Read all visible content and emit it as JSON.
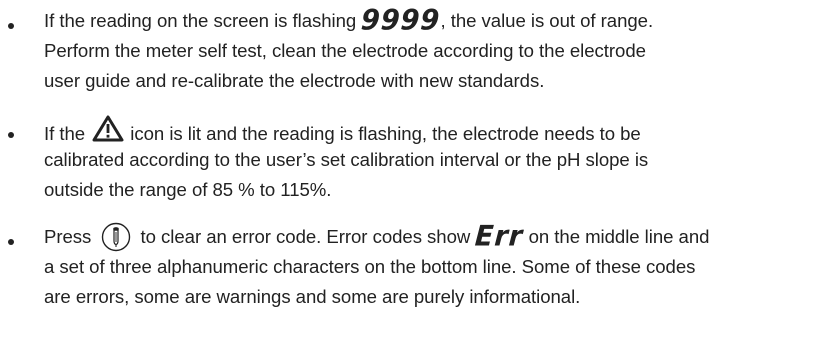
{
  "bullets": [
    {
      "lines": [
        {
          "before": "If the reading on the screen is flashing ",
          "display": "9999",
          "after": ", the value is out of range."
        },
        {
          "text": "Perform the meter self test, clean the electrode according to the electrode"
        },
        {
          "text": "user guide and re-calibrate the electrode with new standards."
        }
      ]
    },
    {
      "lines": [
        {
          "before": "If the ",
          "icon": "warning-triangle-icon",
          "after": " icon is lit and the reading is flashing, the electrode needs to be"
        },
        {
          "text": "calibrated according to the user’s set calibration interval or the pH slope is"
        },
        {
          "text": "outside the range of 85 % to 115%."
        }
      ]
    },
    {
      "lines": [
        {
          "before": "Press ",
          "icon": "electrode-probe-button-icon",
          "middle": " to clear an error code. Error codes show ",
          "display": "Err",
          "after": " on the middle line and"
        },
        {
          "text": "a set of three alphanumeric characters on the bottom line. Some of these codes"
        },
        {
          "text": "are errors, some are warnings and some are purely informational."
        }
      ]
    }
  ]
}
